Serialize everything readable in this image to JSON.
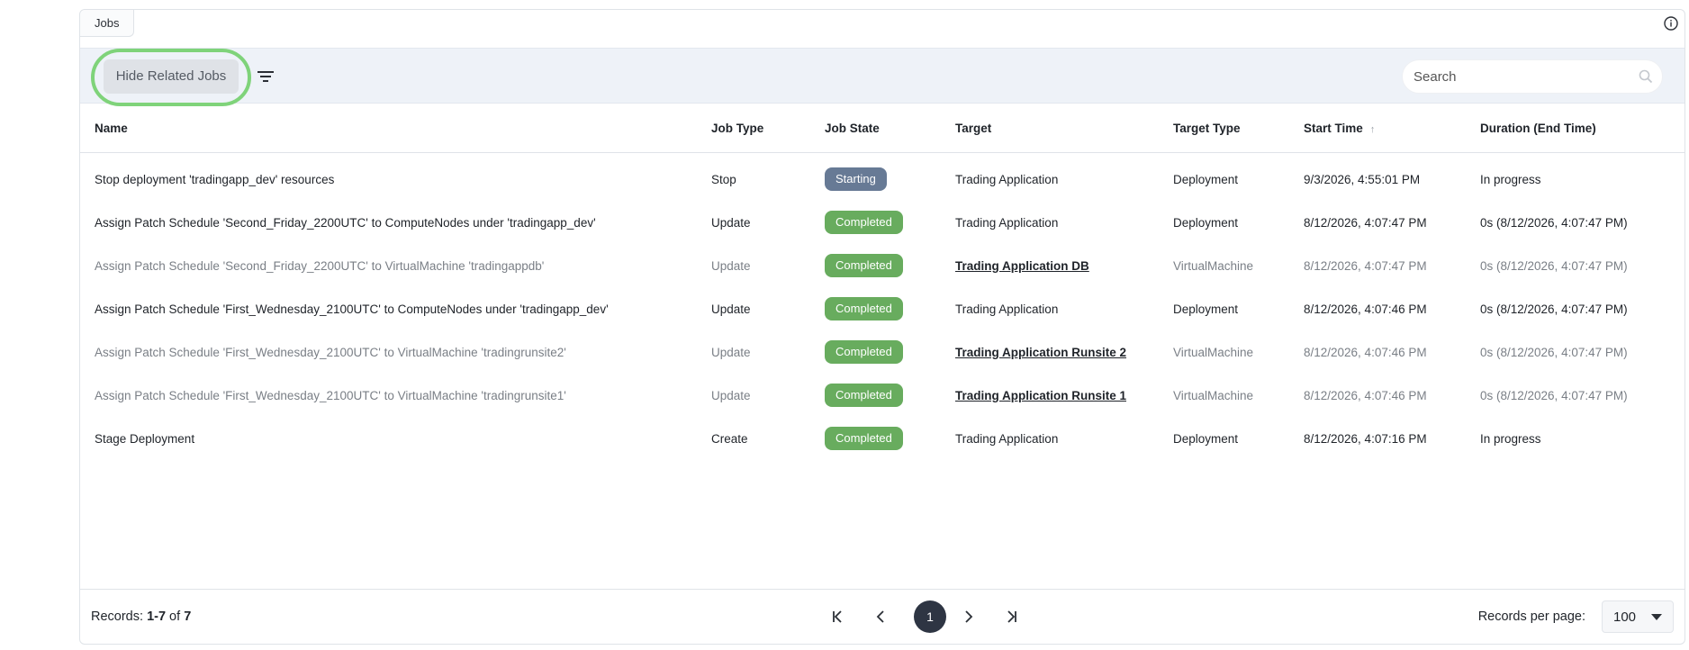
{
  "panel": {
    "tab_label": "Jobs",
    "info_icon": "info-icon"
  },
  "toolbar": {
    "hide_related_label": "Hide Related Jobs",
    "filter_icon": "filter-icon",
    "search_placeholder": "Search",
    "search_icon": "search-icon"
  },
  "table": {
    "columns": {
      "name": "Name",
      "job_type": "Job Type",
      "job_state": "Job State",
      "target": "Target",
      "target_type": "Target Type",
      "start_time": "Start Time",
      "duration": "Duration (End Time)"
    },
    "sort_indicator": "↑",
    "rows": [
      {
        "name": "Stop deployment 'tradingapp_dev' resources",
        "job_type": "Stop",
        "job_state": "Starting",
        "target": "Trading Application",
        "target_type": "Deployment",
        "start_time": "9/3/2026, 4:55:01 PM",
        "duration": "In progress"
      },
      {
        "name": "Assign Patch Schedule 'Second_Friday_2200UTC' to ComputeNodes under 'tradingapp_dev'",
        "job_type": "Update",
        "job_state": "Completed",
        "target": "Trading Application",
        "target_type": "Deployment",
        "start_time": "8/12/2026, 4:07:47 PM",
        "duration": "0s (8/12/2026, 4:07:47 PM)"
      },
      {
        "name": "Assign Patch Schedule 'Second_Friday_2200UTC' to VirtualMachine 'tradingappdb'",
        "job_type": "Update",
        "job_state": "Completed",
        "target": "Trading Application DB",
        "target_type": "VirtualMachine",
        "start_time": "8/12/2026, 4:07:47 PM",
        "duration": "0s (8/12/2026, 4:07:47 PM)"
      },
      {
        "name": "Assign Patch Schedule 'First_Wednesday_2100UTC' to ComputeNodes under 'tradingapp_dev'",
        "job_type": "Update",
        "job_state": "Completed",
        "target": "Trading Application",
        "target_type": "Deployment",
        "start_time": "8/12/2026, 4:07:46 PM",
        "duration": "0s (8/12/2026, 4:07:47 PM)"
      },
      {
        "name": "Assign Patch Schedule 'First_Wednesday_2100UTC' to VirtualMachine 'tradingrunsite2'",
        "job_type": "Update",
        "job_state": "Completed",
        "target": "Trading Application Runsite 2",
        "target_type": "VirtualMachine",
        "start_time": "8/12/2026, 4:07:46 PM",
        "duration": "0s (8/12/2026, 4:07:47 PM)"
      },
      {
        "name": "Assign Patch Schedule 'First_Wednesday_2100UTC' to VirtualMachine 'tradingrunsite1'",
        "job_type": "Update",
        "job_state": "Completed",
        "target": "Trading Application Runsite 1",
        "target_type": "VirtualMachine",
        "start_time": "8/12/2026, 4:07:46 PM",
        "duration": "0s (8/12/2026, 4:07:47 PM)"
      },
      {
        "name": "Stage Deployment",
        "job_type": "Create",
        "job_state": "Completed",
        "target": "Trading Application",
        "target_type": "Deployment",
        "start_time": "8/12/2026, 4:07:16 PM",
        "duration": "In progress"
      }
    ]
  },
  "footer": {
    "records_prefix": "Records: ",
    "records_range": "1-7",
    "records_of": " of ",
    "records_total": "7",
    "current_page": "1",
    "records_per_page_label": "Records per page:",
    "records_per_page_value": "100"
  },
  "colors": {
    "completed": "#68ac5e",
    "starting": "#677a95",
    "highlight_ring": "#7fd37a"
  }
}
